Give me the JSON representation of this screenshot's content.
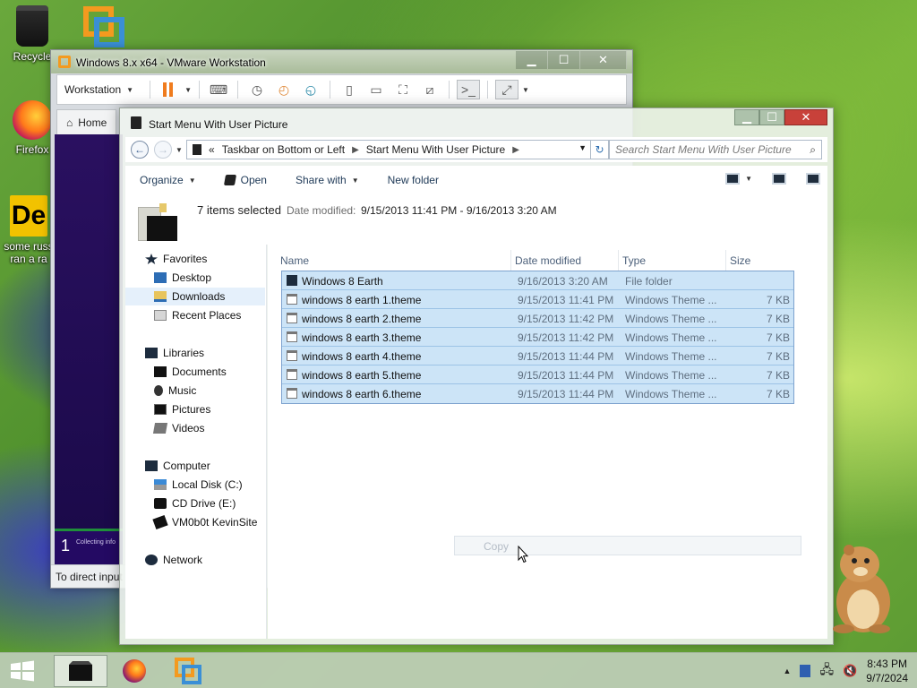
{
  "desktop": {
    "icons": [
      {
        "label": "Recycle"
      },
      {
        "label": "Firefox"
      },
      {
        "label": "some russ ran a ra"
      }
    ]
  },
  "vmware": {
    "title": "Windows 8.x x64 - VMware Workstation",
    "menu_label": "Workstation",
    "home_tab": "Home",
    "status_number": "1",
    "status_message": "Collecting info",
    "footer_text": "To direct input"
  },
  "explorer": {
    "title": "Start Menu With User Picture",
    "breadcrumb": [
      "Taskbar on Bottom or Left",
      "Start Menu With User Picture"
    ],
    "breadcrumb_prefix": "«",
    "search_placeholder": "Search Start Menu With User Picture",
    "commands": {
      "organize": "Organize",
      "open": "Open",
      "share_with": "Share with",
      "new_folder": "New folder"
    },
    "details": {
      "count": "7 items selected",
      "date_label": "Date modified:",
      "date_value": "9/15/2013 11:41 PM - 9/16/2013 3:20 AM"
    },
    "nav": {
      "favorites": "Favorites",
      "desktop": "Desktop",
      "downloads": "Downloads",
      "recent": "Recent Places",
      "libraries": "Libraries",
      "documents": "Documents",
      "music": "Music",
      "pictures": "Pictures",
      "videos": "Videos",
      "computer": "Computer",
      "local_disk": "Local Disk (C:)",
      "cd_drive": "CD Drive (E:)",
      "share": "VM0b0t KevinSite",
      "network": "Network"
    },
    "columns": {
      "name": "Name",
      "date": "Date modified",
      "type": "Type",
      "size": "Size"
    },
    "files": [
      {
        "name": "Windows 8 Earth",
        "date": "9/16/2013 3:20 AM",
        "type": "File folder",
        "size": ""
      },
      {
        "name": "windows 8 earth 1.theme",
        "date": "9/15/2013 11:41 PM",
        "type": "Windows Theme ...",
        "size": "7 KB"
      },
      {
        "name": "windows 8 earth 2.theme",
        "date": "9/15/2013 11:42 PM",
        "type": "Windows Theme ...",
        "size": "7 KB"
      },
      {
        "name": "windows 8 earth 3.theme",
        "date": "9/15/2013 11:42 PM",
        "type": "Windows Theme ...",
        "size": "7 KB"
      },
      {
        "name": "windows 8 earth 4.theme",
        "date": "9/15/2013 11:44 PM",
        "type": "Windows Theme ...",
        "size": "7 KB"
      },
      {
        "name": "windows 8 earth 5.theme",
        "date": "9/15/2013 11:44 PM",
        "type": "Windows Theme ...",
        "size": "7 KB"
      },
      {
        "name": "windows 8 earth 6.theme",
        "date": "9/15/2013 11:44 PM",
        "type": "Windows Theme ...",
        "size": "7 KB"
      }
    ],
    "drag_tooltip": "Copy"
  },
  "taskbar": {
    "time": "8:43 PM",
    "date": "9/7/2024"
  },
  "colors": {
    "selection_fill": "#cce4f7",
    "selection_border": "#7da2ce",
    "vmware_accent": "#f07c1e"
  }
}
